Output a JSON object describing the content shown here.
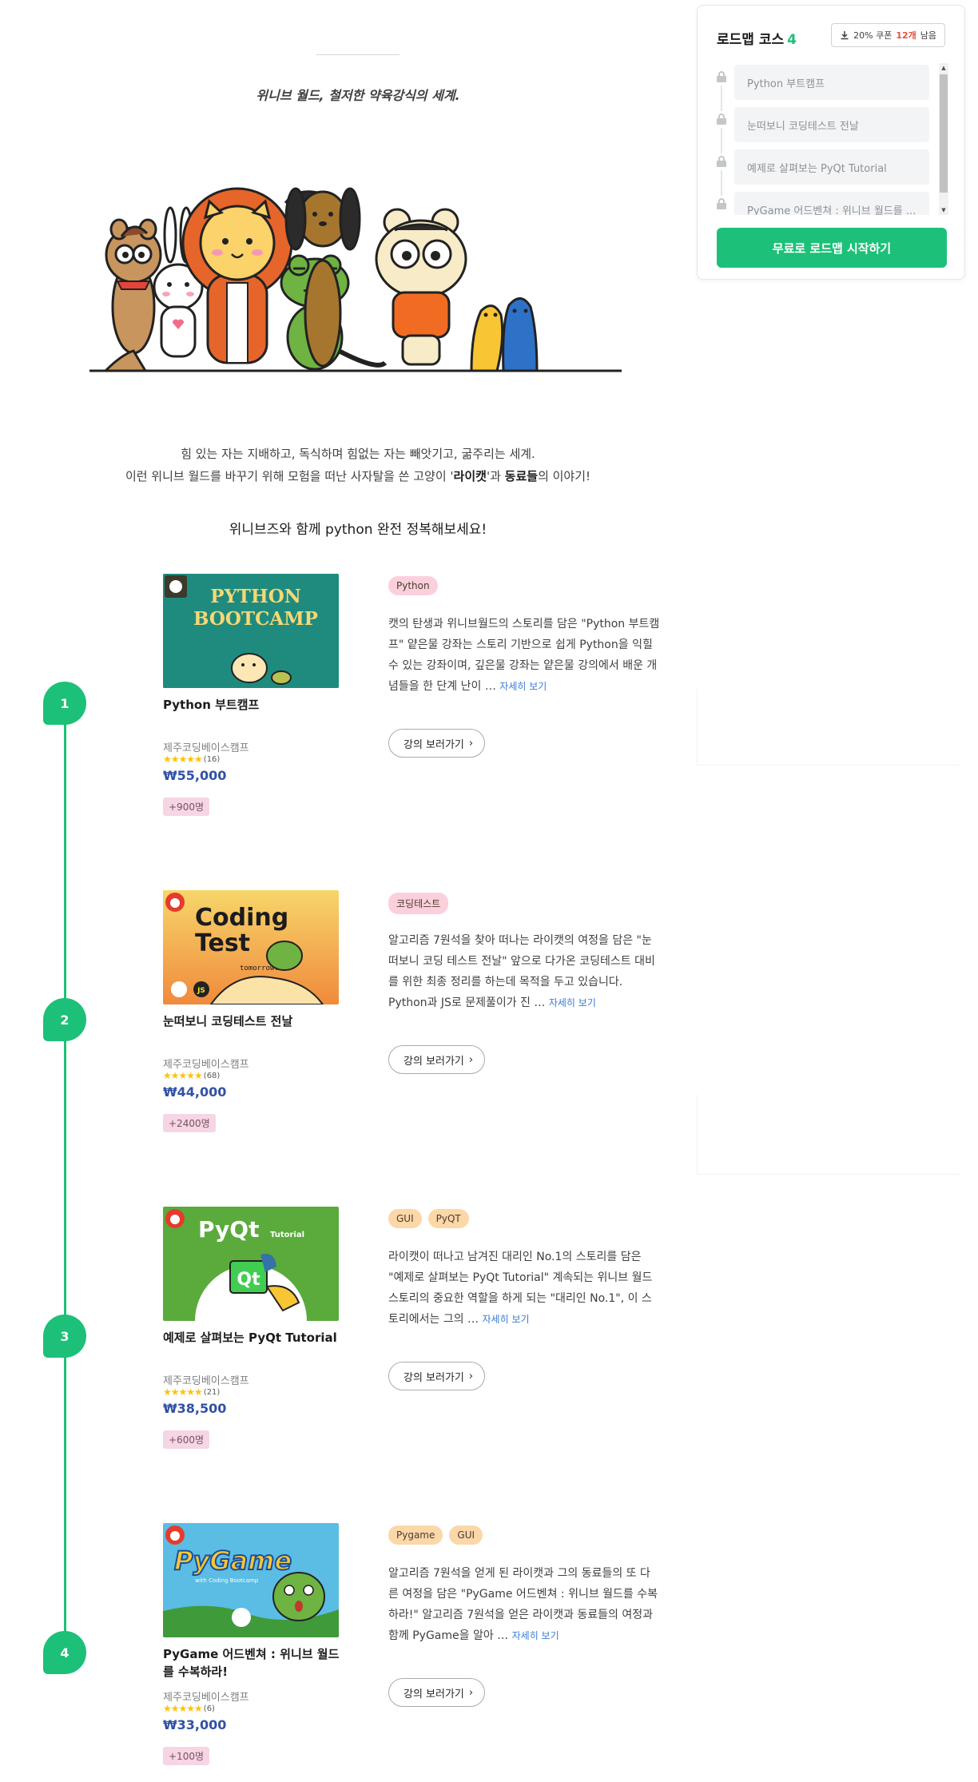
{
  "intro": {
    "tagline": "위니브 월드, 철저한 약육강식의 세계.",
    "line1": "힘 있는 자는 지배하고, 독식하며 힘없는 자는 빼앗기고, 굶주리는 세계.",
    "line2_pre": "이런 위니브 월드를 바꾸기 위해 모험을 떠난 사자탈을 쓴 고양이 '",
    "line2_bold1": "라이캣",
    "line2_mid": "'과 ",
    "line2_bold2": "동료들",
    "line2_post": "의 이야기!",
    "subheading": "위니브즈와 함께 python 완전 정복해보세요!"
  },
  "sidebar": {
    "title": "로드맵 코스",
    "course_count": "4",
    "coupon_prefix": "20% 쿠폰",
    "coupon_count": "12개",
    "coupon_suffix": "남음",
    "items": [
      {
        "label": "Python 부트캠프"
      },
      {
        "label": "눈떠보니 코딩테스트 전날"
      },
      {
        "label": "예제로 살펴보는 PyQt Tutorial"
      },
      {
        "label": "PyGame 어드벤쳐 : 위니브 월드를 ..."
      }
    ],
    "start_button": "무료로 로드맵 시작하기"
  },
  "courses": [
    {
      "step": "1",
      "thumb_title_1": "PYTHON",
      "thumb_title_2": "BOOTCAMP",
      "title": "Python 부트캠프",
      "instructor": "제주코딩베이스캠프",
      "stars": "★★★★★",
      "reviews": "(16)",
      "price": "₩55,000",
      "students": "+900명",
      "tags": [
        "Python"
      ],
      "description": "캣의 탄생과 위니브월드의 스토리를 담은 \"Python 부트캠프\" 얕은물 강좌는 스토리 기반으로 쉽게 Python을 익힐 수 있는 강좌이며, 깊은물 강좌는 얕은물 강의에서 배운 개념들을 한 단계 난이 …",
      "more": "자세히 보기",
      "button": "강의 보러가기"
    },
    {
      "step": "2",
      "thumb_title_1": "Coding",
      "thumb_title_2": "Test",
      "thumb_sub": "tomorrow...",
      "thumb_js": "JS",
      "title": "눈떠보니 코딩테스트 전날",
      "instructor": "제주코딩베이스캠프",
      "stars": "★★★★★",
      "reviews": "(68)",
      "price": "₩44,000",
      "students": "+2400명",
      "tags": [
        "코딩테스트"
      ],
      "description": "알고리즘 7원석을 찾아 떠나는 라이캣의 여정을 담은 \"눈떠보니 코딩 테스트 전날\" 앞으로 다가온 코딩테스트 대비를 위한 최종 정리를 하는데 목적을 두고 있습니다. Python과 JS로 문제풀이가 진 …",
      "more": "자세히 보기",
      "button": "강의 보러가기"
    },
    {
      "step": "3",
      "thumb_title_1": "PyQt",
      "thumb_title_2": "Tutorial",
      "thumb_qt": "Qt",
      "title": "예제로 살펴보는 PyQt Tutorial",
      "instructor": "제주코딩베이스캠프",
      "stars": "★★★★★",
      "reviews": "(21)",
      "price": "₩38,500",
      "students": "+600명",
      "tags": [
        "GUI",
        "PyQT"
      ],
      "description": "라이캣이 떠나고 남겨진 대리인 No.1의 스토리를 담은 \"예제로 살펴보는 PyQt Tutorial\" 계속되는 위니브 월드 스토리의 중요한 역할을 하게 되는 \"대리인 No.1\", 이 스토리에서는 그의 …",
      "more": "자세히 보기",
      "button": "강의 보러가기"
    },
    {
      "step": "4",
      "thumb_title_1": "PyGame",
      "thumb_sub": "with Coding Bootcamp",
      "title": "PyGame 어드벤쳐 : 위니브 월드를 수복하라!",
      "instructor": "제주코딩베이스캠프",
      "stars": "★★★★★",
      "reviews": "(6)",
      "price": "₩33,000",
      "students": "+100명",
      "tags": [
        "Pygame",
        "GUI"
      ],
      "description": "알고리즘 7원석을 얻게 된 라이캣과 그의 동료들의 또 다른 여정을 담은 \"PyGame 어드벤쳐 : 위니브 월드를 수복하라!\" 알고리즘 7원석을 얻은 라이캣과 동료들의 여정과 함께 PyGame을 알아 …",
      "more": "자세히 보기",
      "button": "강의 보러가기"
    }
  ]
}
